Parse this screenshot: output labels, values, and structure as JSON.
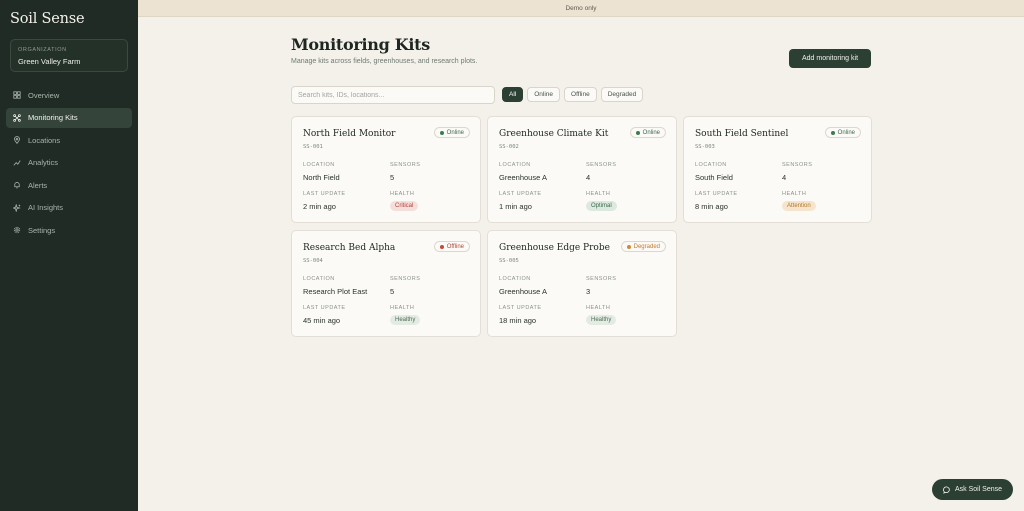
{
  "app": {
    "name": "Soil Sense"
  },
  "organization": {
    "label": "ORGANIZATION",
    "name": "Green Valley Farm"
  },
  "nav": [
    {
      "label": "Overview",
      "icon": "grid-icon"
    },
    {
      "label": "Monitoring Kits",
      "icon": "network-icon",
      "active": true
    },
    {
      "label": "Locations",
      "icon": "pin-icon"
    },
    {
      "label": "Analytics",
      "icon": "trend-icon"
    },
    {
      "label": "Alerts",
      "icon": "bell-icon"
    },
    {
      "label": "AI Insights",
      "icon": "sparkle-icon"
    },
    {
      "label": "Settings",
      "icon": "gear-icon"
    }
  ],
  "banner": {
    "text": "Demo only"
  },
  "header": {
    "title": "Monitoring Kits",
    "subtitle": "Manage kits across fields, greenhouses, and research plots.",
    "add_label": "Add monitoring kit"
  },
  "search": {
    "placeholder": "Search kits, IDs, locations...",
    "value": ""
  },
  "filters": [
    {
      "label": "All",
      "active": true
    },
    {
      "label": "Online"
    },
    {
      "label": "Offline"
    },
    {
      "label": "Degraded"
    }
  ],
  "labels": {
    "location": "LOCATION",
    "sensors": "SENSORS",
    "last_update": "LAST UPDATE",
    "health": "HEALTH"
  },
  "kits": [
    {
      "name": "North Field Monitor",
      "id": "SS-001",
      "status": "Online",
      "location": "North Field",
      "sensors": "5",
      "last_update": "2 min ago",
      "health": "Critical"
    },
    {
      "name": "Greenhouse Climate Kit",
      "id": "SS-002",
      "status": "Online",
      "location": "Greenhouse A",
      "sensors": "4",
      "last_update": "1 min ago",
      "health": "Optimal"
    },
    {
      "name": "South Field Sentinel",
      "id": "SS-003",
      "status": "Online",
      "location": "South Field",
      "sensors": "4",
      "last_update": "8 min ago",
      "health": "Attention"
    },
    {
      "name": "Research Bed Alpha",
      "id": "SS-004",
      "status": "Offline",
      "location": "Research Plot East",
      "sensors": "5",
      "last_update": "45 min ago",
      "health": "Healthy"
    },
    {
      "name": "Greenhouse Edge Probe",
      "id": "SS-005",
      "status": "Degraded",
      "location": "Greenhouse A",
      "sensors": "3",
      "last_update": "18 min ago",
      "health": "Healthy"
    }
  ],
  "ask": {
    "label": "Ask Soil Sense"
  },
  "colors": {
    "sidebar": "#1f2b24",
    "accent": "#2b3f33",
    "background": "#f4f1ea"
  }
}
